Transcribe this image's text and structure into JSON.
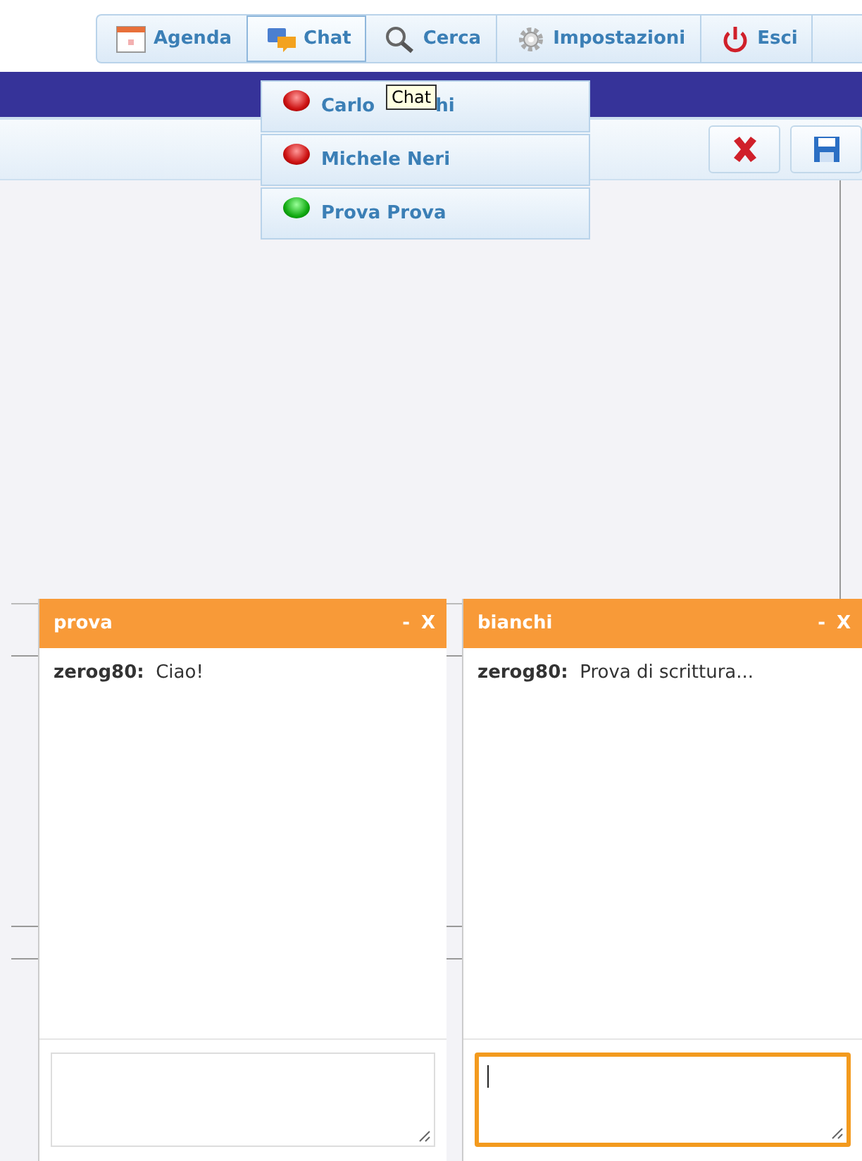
{
  "nav": {
    "tabs": [
      {
        "label": "Agenda",
        "selected": false
      },
      {
        "label": "Chat",
        "selected": true
      },
      {
        "label": "Cerca",
        "selected": false
      },
      {
        "label": "Impostazioni",
        "selected": false
      },
      {
        "label": "Esci",
        "selected": false
      }
    ]
  },
  "tooltip": "Chat",
  "chat_menu": {
    "items": [
      {
        "name_parts": [
          "Carlo",
          "hi"
        ],
        "online": false
      },
      {
        "name_parts": [
          "Michele Neri"
        ],
        "online": false
      },
      {
        "name_parts": [
          "Prova Prova"
        ],
        "online": true
      }
    ]
  },
  "toolbar": {
    "buttons": [
      {
        "kind": "delete"
      },
      {
        "kind": "save"
      }
    ]
  },
  "chat_windows": [
    {
      "title": "prova",
      "minimize": "-",
      "close": "X",
      "messages": [
        {
          "sender": "zerog80:",
          "text": "Ciao!"
        }
      ],
      "input_focused": false
    },
    {
      "title": "bianchi",
      "minimize": "-",
      "close": "X",
      "messages": [
        {
          "sender": "zerog80:",
          "text": "Prova di scrittura..."
        }
      ],
      "input_focused": true
    }
  ]
}
